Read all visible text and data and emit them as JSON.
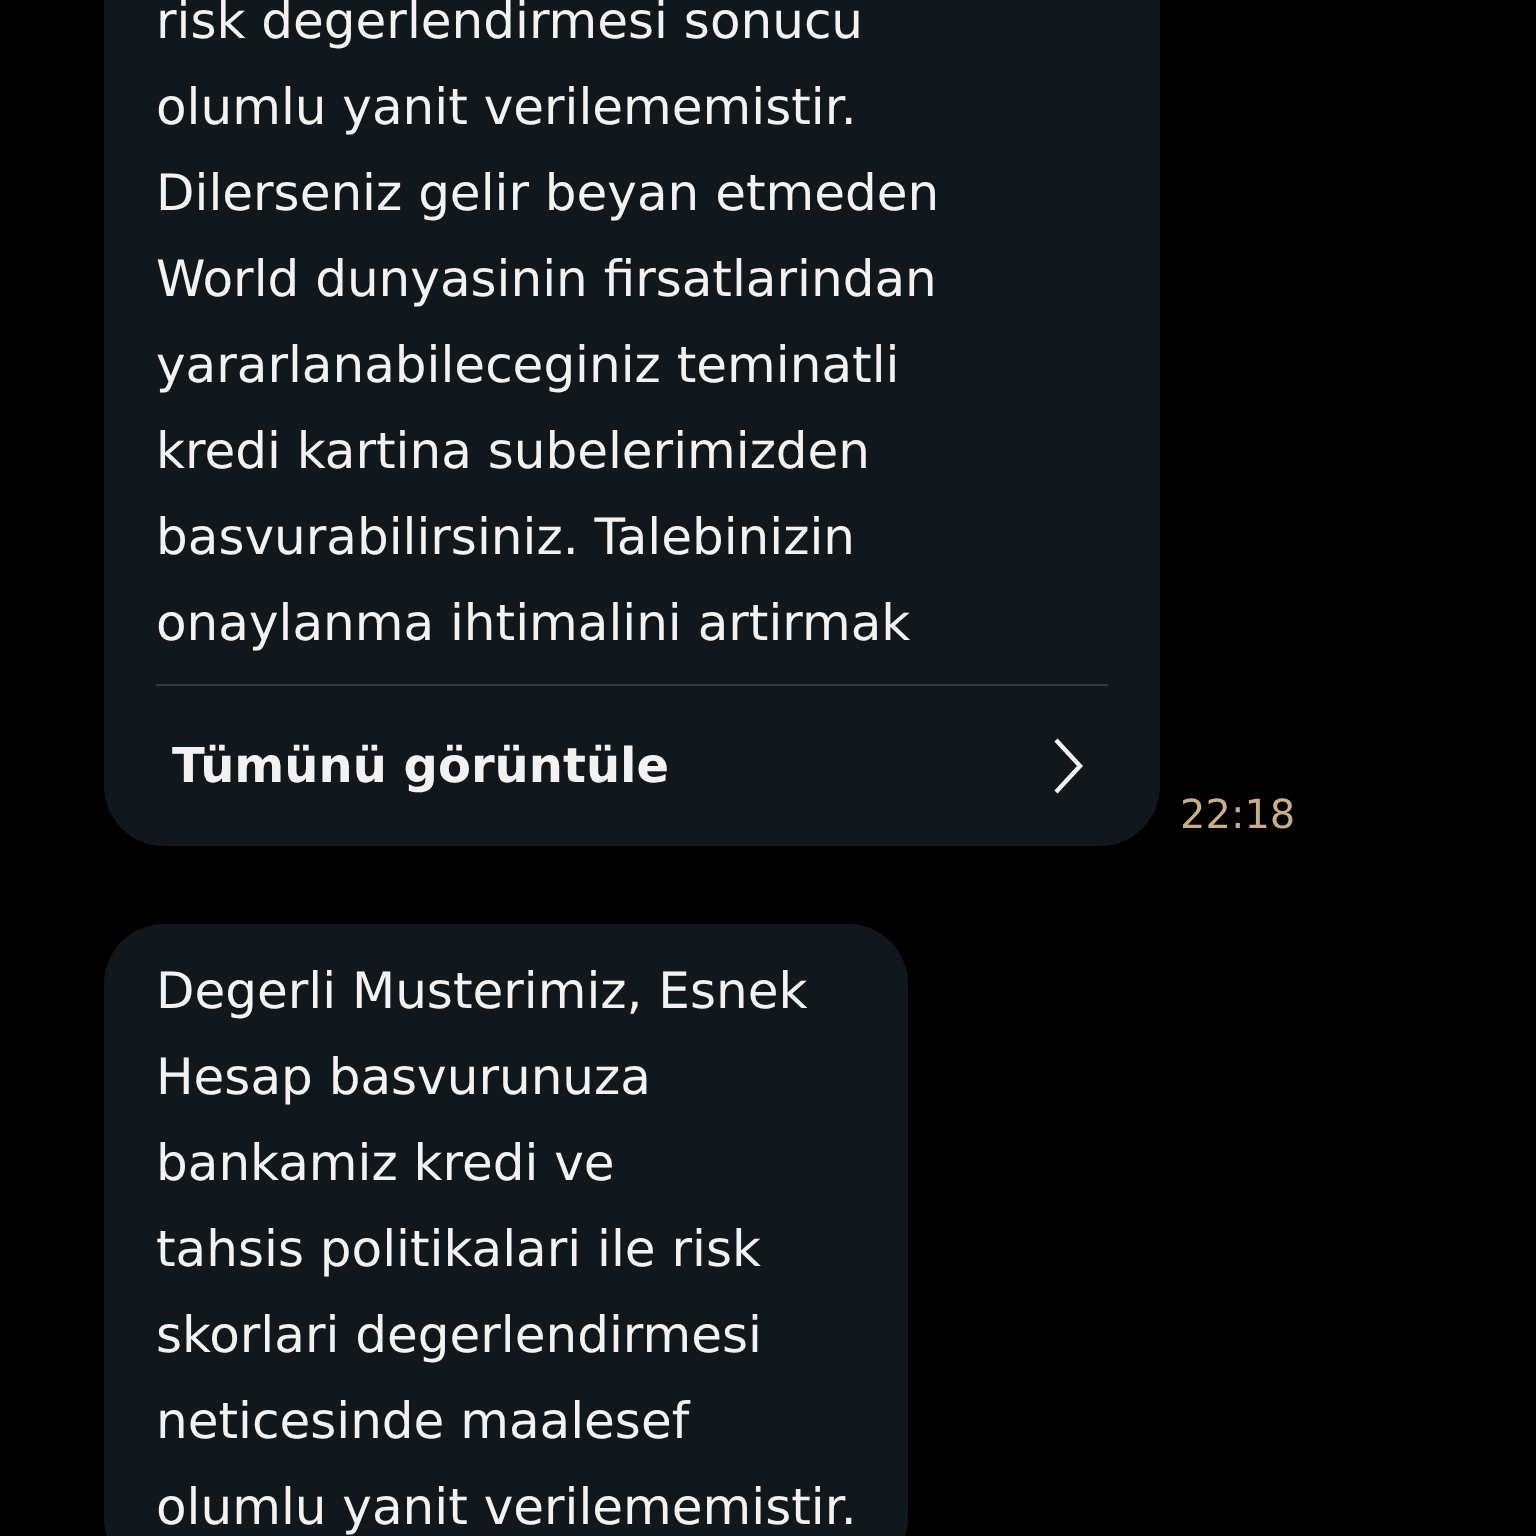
{
  "messages": [
    {
      "lines": [
        "risk degerlendirmesi sonucu",
        "olumlu yanit verilememistir.",
        "Dilerseniz gelir beyan etmeden",
        "World dunyasinin firsatlarindan",
        "yararlanabileceginiz teminatli",
        "kredi kartina subelerimizden",
        "basvurabilirsiniz. Talebinizin",
        "onaylanma ihtimalini artirmak"
      ],
      "action": "Tümünü görüntüle",
      "time": "22:18"
    },
    {
      "lines": [
        "Degerli Musterimiz, Esnek",
        "Hesap basvurunuza",
        "bankamiz kredi ve",
        "tahsis politikalari ile risk",
        "skorlari degerlendirmesi",
        "neticesinde maalesef",
        "olumlu yanit verilememistir."
      ]
    }
  ]
}
